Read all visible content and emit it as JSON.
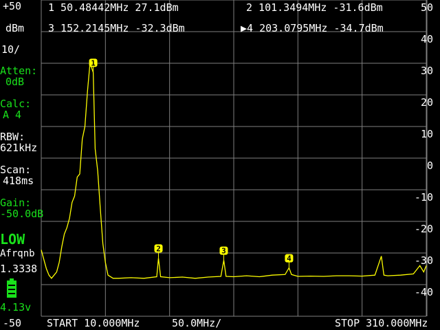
{
  "left_panel": {
    "ref_level": "+50",
    "unit": "dBm",
    "scale": "10/",
    "atten_label": "Atten:",
    "atten_value": "0dB",
    "calc_label": "Calc:",
    "calc_value": "A 4",
    "rbw_label": "RBW:",
    "rbw_value": "621kHz",
    "scan_label": "Scan:",
    "scan_value": "418ms",
    "gain_label": "Gain:",
    "gain_value": "-50.0dB",
    "mode": "LOW",
    "mode_sub": "Afrqnb",
    "version": "1.3338",
    "battery_voltage": "4.13v",
    "bottom_level": "-50"
  },
  "markers": [
    {
      "id": "1",
      "text": "1 50.48442MHz 27.1dBm",
      "freq_mhz": 50.48442,
      "level_dbm": 27.1
    },
    {
      "id": "2",
      "text": "2 101.3494MHz -31.6dBm",
      "freq_mhz": 101.3494,
      "level_dbm": -31.6
    },
    {
      "id": "3",
      "text": "3 152.2145MHz -32.3dBm",
      "freq_mhz": 152.2145,
      "level_dbm": -32.3
    },
    {
      "id": "4",
      "text": "▶4 203.0795MHz -34.7dBm",
      "freq_mhz": 203.0795,
      "level_dbm": -34.7
    }
  ],
  "y_ticks": [
    "50",
    "40",
    "30",
    "20",
    "10",
    "0",
    "-10",
    "-20",
    "-30",
    "-40"
  ],
  "bottom_bar": {
    "start": "START 10.000MHz",
    "per_div": "50.0MHz/",
    "stop": "STOP 310.000MHz"
  },
  "colors": {
    "trace": "#ffff00",
    "grid": "#808080",
    "label_green": "#19e11b",
    "text": "#ffffff"
  },
  "chart_data": {
    "type": "line",
    "x_range_mhz": [
      10,
      310
    ],
    "y_range_dbm": [
      -50,
      50
    ],
    "series": [
      {
        "x": [
          10,
          12,
          14,
          16,
          18,
          20,
          22,
          24,
          26,
          28,
          30,
          32,
          34,
          36,
          38,
          40,
          42,
          44,
          46,
          48,
          50.48,
          52,
          54,
          56,
          58,
          60,
          62,
          66,
          70,
          80,
          90,
          100,
          101.35,
          103,
          110,
          120,
          130,
          140,
          150,
          152.21,
          154,
          160,
          170,
          180,
          190,
          200,
          203.08,
          205,
          210,
          220,
          230,
          240,
          250,
          260,
          270,
          275,
          277,
          280,
          290,
          300,
          305,
          308,
          310
        ],
        "y": [
          -29,
          -32,
          -35,
          -37,
          -38,
          -37,
          -36,
          -33,
          -28,
          -24,
          -22,
          -19,
          -14,
          -12,
          -6,
          -5,
          6,
          10,
          21,
          30,
          27.1,
          3,
          -4,
          -16,
          -27,
          -33,
          -37,
          -38,
          -38,
          -37.8,
          -38,
          -37.5,
          -31.6,
          -37.5,
          -37.8,
          -37.6,
          -38,
          -37.6,
          -37.4,
          -32.3,
          -37.4,
          -37.5,
          -37.2,
          -37.5,
          -37,
          -36.8,
          -34.7,
          -36.8,
          -37.4,
          -37.3,
          -37.4,
          -37.2,
          -37.2,
          -37.3,
          -37.0,
          -31,
          -37,
          -37.2,
          -37.0,
          -36.6,
          -34,
          -36,
          -34
        ]
      }
    ]
  }
}
